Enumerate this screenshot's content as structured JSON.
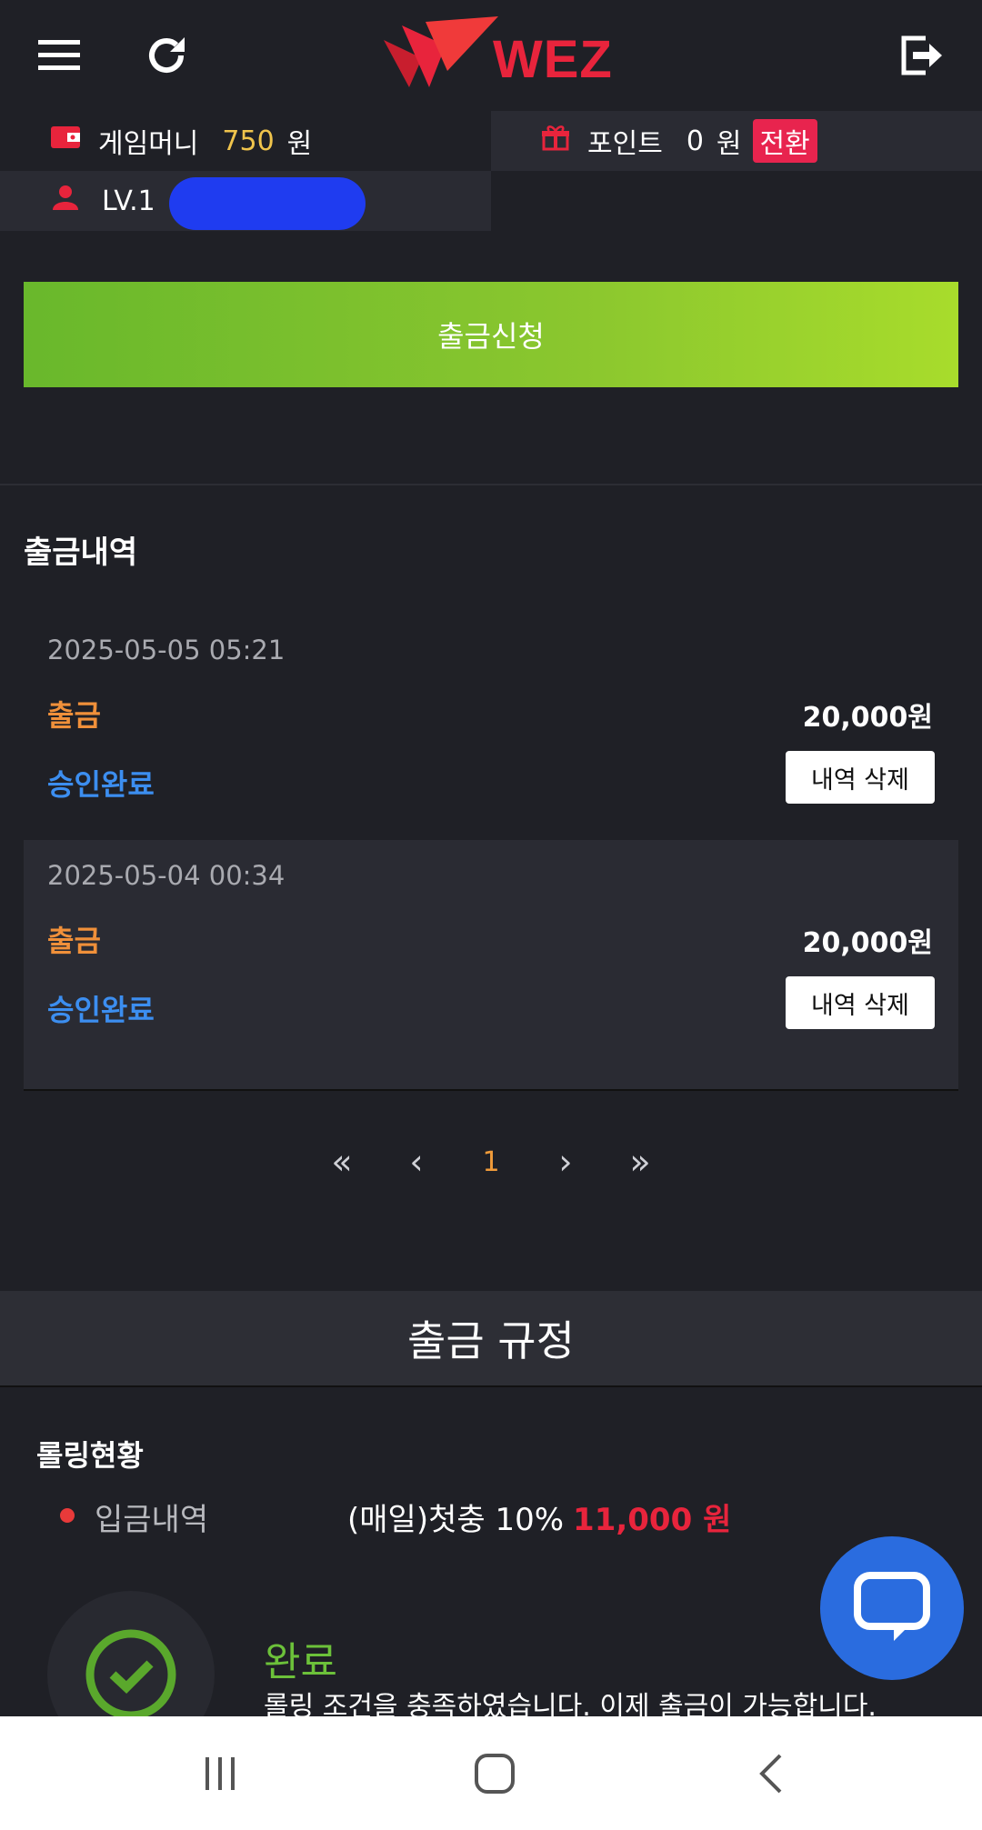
{
  "header": {
    "menu_icon": "hamburger-menu-icon",
    "refresh_icon": "refresh-icon",
    "logo_text": "WEZ",
    "logout_icon": "logout-icon"
  },
  "wallet": {
    "money_label": "게임머니",
    "money_value": "750",
    "money_unit": "원",
    "point_label": "포인트",
    "point_value": "0",
    "point_unit": "원",
    "convert_label": "전환",
    "level": "LV.1"
  },
  "withdraw_button": "출금신청",
  "history": {
    "title": "출금내역",
    "items": [
      {
        "date": "2025-05-05 05:21",
        "kind": "출금",
        "amount": "20,000원",
        "status": "승인완료",
        "delete_label": "내역 삭제"
      },
      {
        "date": "2025-05-04 00:34",
        "kind": "출금",
        "amount": "20,000원",
        "status": "승인완료",
        "delete_label": "내역 삭제"
      }
    ]
  },
  "pagination": {
    "first": "«",
    "prev": "‹",
    "current": "1",
    "next": "›",
    "last": "»"
  },
  "rules": {
    "title": "출금 규정",
    "rolling_title": "롤링현황",
    "deposit_label": "입금내역",
    "deposit_info": "(매일)첫충 10%",
    "deposit_amount": "11,000 원",
    "done_title": "완료",
    "done_text": "롤링 조건을 충족하였습니다. 이제 출금이 가능합니다."
  },
  "colors": {
    "accent_green": "#8bc72e",
    "amount_red": "#e8243c",
    "status_blue": "#3c8ef0",
    "kind_orange": "#f0903a",
    "chat_blue": "#2a6cdf"
  }
}
